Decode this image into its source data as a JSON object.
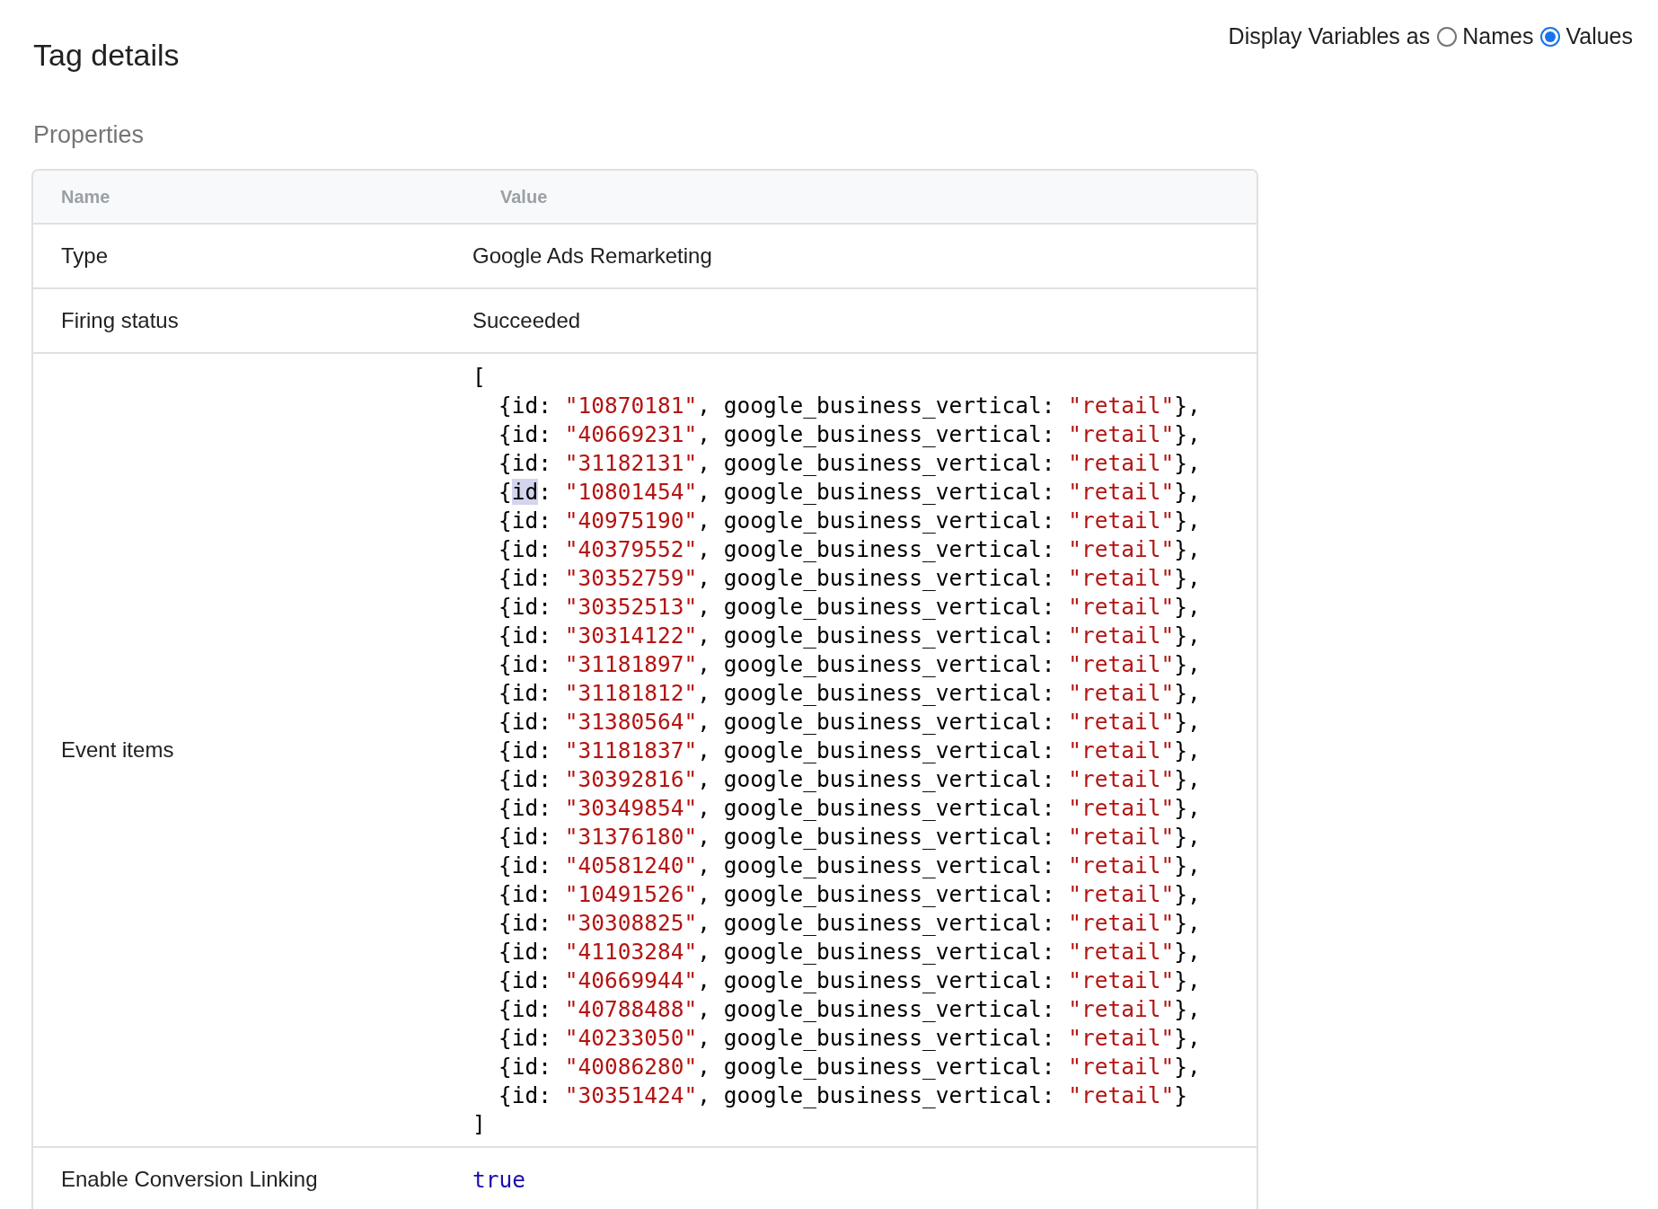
{
  "title": "Tag details",
  "display_variables": {
    "label": "Display Variables as",
    "options": [
      {
        "label": "Names",
        "selected": false
      },
      {
        "label": "Values",
        "selected": true
      }
    ]
  },
  "section_title": "Properties",
  "table": {
    "columns": [
      "Name",
      "Value"
    ],
    "rows": [
      {
        "kind": "text",
        "name": "Type",
        "value": "Google Ads Remarketing"
      },
      {
        "kind": "text",
        "name": "Firing status",
        "value": "Succeeded"
      },
      {
        "kind": "list",
        "name": "Event items",
        "open": "[",
        "close": "]",
        "items": [
          {
            "open": "{",
            "key": "id",
            "key_highlighted": false,
            "sep": ": ",
            "id": "\"10870181\"",
            "middle": ", google_business_vertical: ",
            "value": "\"retail\"",
            "suffix": "},"
          },
          {
            "open": "{",
            "key": "id",
            "key_highlighted": false,
            "sep": ": ",
            "id": "\"40669231\"",
            "middle": ", google_business_vertical: ",
            "value": "\"retail\"",
            "suffix": "},"
          },
          {
            "open": "{",
            "key": "id",
            "key_highlighted": false,
            "sep": ": ",
            "id": "\"31182131\"",
            "middle": ", google_business_vertical: ",
            "value": "\"retail\"",
            "suffix": "},"
          },
          {
            "open": "{",
            "key": "id",
            "key_highlighted": true,
            "sep": ": ",
            "id": "\"10801454\"",
            "middle": ", google_business_vertical: ",
            "value": "\"retail\"",
            "suffix": "},"
          },
          {
            "open": "{",
            "key": "id",
            "key_highlighted": false,
            "sep": ": ",
            "id": "\"40975190\"",
            "middle": ", google_business_vertical: ",
            "value": "\"retail\"",
            "suffix": "},"
          },
          {
            "open": "{",
            "key": "id",
            "key_highlighted": false,
            "sep": ": ",
            "id": "\"40379552\"",
            "middle": ", google_business_vertical: ",
            "value": "\"retail\"",
            "suffix": "},"
          },
          {
            "open": "{",
            "key": "id",
            "key_highlighted": false,
            "sep": ": ",
            "id": "\"30352759\"",
            "middle": ", google_business_vertical: ",
            "value": "\"retail\"",
            "suffix": "},"
          },
          {
            "open": "{",
            "key": "id",
            "key_highlighted": false,
            "sep": ": ",
            "id": "\"30352513\"",
            "middle": ", google_business_vertical: ",
            "value": "\"retail\"",
            "suffix": "},"
          },
          {
            "open": "{",
            "key": "id",
            "key_highlighted": false,
            "sep": ": ",
            "id": "\"30314122\"",
            "middle": ", google_business_vertical: ",
            "value": "\"retail\"",
            "suffix": "},"
          },
          {
            "open": "{",
            "key": "id",
            "key_highlighted": false,
            "sep": ": ",
            "id": "\"31181897\"",
            "middle": ", google_business_vertical: ",
            "value": "\"retail\"",
            "suffix": "},"
          },
          {
            "open": "{",
            "key": "id",
            "key_highlighted": false,
            "sep": ": ",
            "id": "\"31181812\"",
            "middle": ", google_business_vertical: ",
            "value": "\"retail\"",
            "suffix": "},"
          },
          {
            "open": "{",
            "key": "id",
            "key_highlighted": false,
            "sep": ": ",
            "id": "\"31380564\"",
            "middle": ", google_business_vertical: ",
            "value": "\"retail\"",
            "suffix": "},"
          },
          {
            "open": "{",
            "key": "id",
            "key_highlighted": false,
            "sep": ": ",
            "id": "\"31181837\"",
            "middle": ", google_business_vertical: ",
            "value": "\"retail\"",
            "suffix": "},"
          },
          {
            "open": "{",
            "key": "id",
            "key_highlighted": false,
            "sep": ": ",
            "id": "\"30392816\"",
            "middle": ", google_business_vertical: ",
            "value": "\"retail\"",
            "suffix": "},"
          },
          {
            "open": "{",
            "key": "id",
            "key_highlighted": false,
            "sep": ": ",
            "id": "\"30349854\"",
            "middle": ", google_business_vertical: ",
            "value": "\"retail\"",
            "suffix": "},"
          },
          {
            "open": "{",
            "key": "id",
            "key_highlighted": false,
            "sep": ": ",
            "id": "\"31376180\"",
            "middle": ", google_business_vertical: ",
            "value": "\"retail\"",
            "suffix": "},"
          },
          {
            "open": "{",
            "key": "id",
            "key_highlighted": false,
            "sep": ": ",
            "id": "\"40581240\"",
            "middle": ", google_business_vertical: ",
            "value": "\"retail\"",
            "suffix": "},"
          },
          {
            "open": "{",
            "key": "id",
            "key_highlighted": false,
            "sep": ": ",
            "id": "\"10491526\"",
            "middle": ", google_business_vertical: ",
            "value": "\"retail\"",
            "suffix": "},"
          },
          {
            "open": "{",
            "key": "id",
            "key_highlighted": false,
            "sep": ": ",
            "id": "\"30308825\"",
            "middle": ", google_business_vertical: ",
            "value": "\"retail\"",
            "suffix": "},"
          },
          {
            "open": "{",
            "key": "id",
            "key_highlighted": false,
            "sep": ": ",
            "id": "\"41103284\"",
            "middle": ", google_business_vertical: ",
            "value": "\"retail\"",
            "suffix": "},"
          },
          {
            "open": "{",
            "key": "id",
            "key_highlighted": false,
            "sep": ": ",
            "id": "\"40669944\"",
            "middle": ", google_business_vertical: ",
            "value": "\"retail\"",
            "suffix": "},"
          },
          {
            "open": "{",
            "key": "id",
            "key_highlighted": false,
            "sep": ": ",
            "id": "\"40788488\"",
            "middle": ", google_business_vertical: ",
            "value": "\"retail\"",
            "suffix": "},"
          },
          {
            "open": "{",
            "key": "id",
            "key_highlighted": false,
            "sep": ": ",
            "id": "\"40233050\"",
            "middle": ", google_business_vertical: ",
            "value": "\"retail\"",
            "suffix": "},"
          },
          {
            "open": "{",
            "key": "id",
            "key_highlighted": false,
            "sep": ": ",
            "id": "\"40086280\"",
            "middle": ", google_business_vertical: ",
            "value": "\"retail\"",
            "suffix": "},"
          },
          {
            "open": "{",
            "key": "id",
            "key_highlighted": false,
            "sep": ": ",
            "id": "\"30351424\"",
            "middle": ", google_business_vertical: ",
            "value": "\"retail\"",
            "suffix": "}"
          }
        ]
      },
      {
        "kind": "boolean",
        "name": "Enable Conversion Linking",
        "value": "true"
      }
    ]
  }
}
